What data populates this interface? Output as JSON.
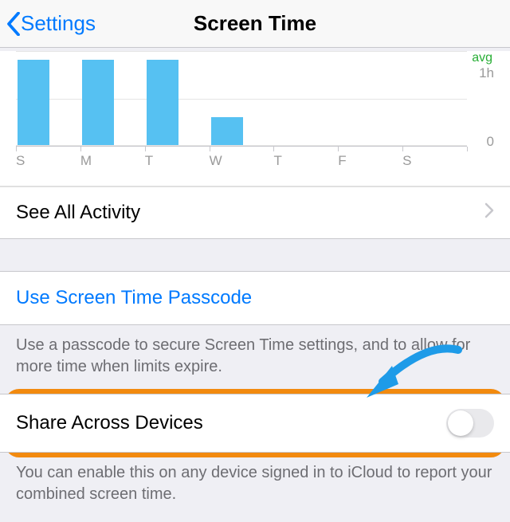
{
  "nav": {
    "back_label": "Settings",
    "title": "Screen Time"
  },
  "chart_data": {
    "type": "bar",
    "categories": [
      "S",
      "M",
      "T",
      "W",
      "T",
      "F",
      "S"
    ],
    "values": [
      1.8,
      1.8,
      1.8,
      0.6,
      0,
      0,
      0
    ],
    "ylabel_top": "1h",
    "ylabel_bot": "0",
    "ylim": [
      0,
      2
    ],
    "avg_label": "avg"
  },
  "rows": {
    "see_all": "See All Activity",
    "passcode_link": "Use Screen Time Passcode",
    "passcode_footer": "Use a passcode to secure Screen Time settings, and to allow for more time when limits expire.",
    "share_label": "Share Across Devices",
    "share_footer": "You can enable this on any device signed in to iCloud to report your combined screen time.",
    "share_enabled": false
  },
  "colors": {
    "accent": "#007aff",
    "bars": "#56c1f2",
    "highlight": "#f28a0f",
    "arrow": "#1e9be8"
  }
}
